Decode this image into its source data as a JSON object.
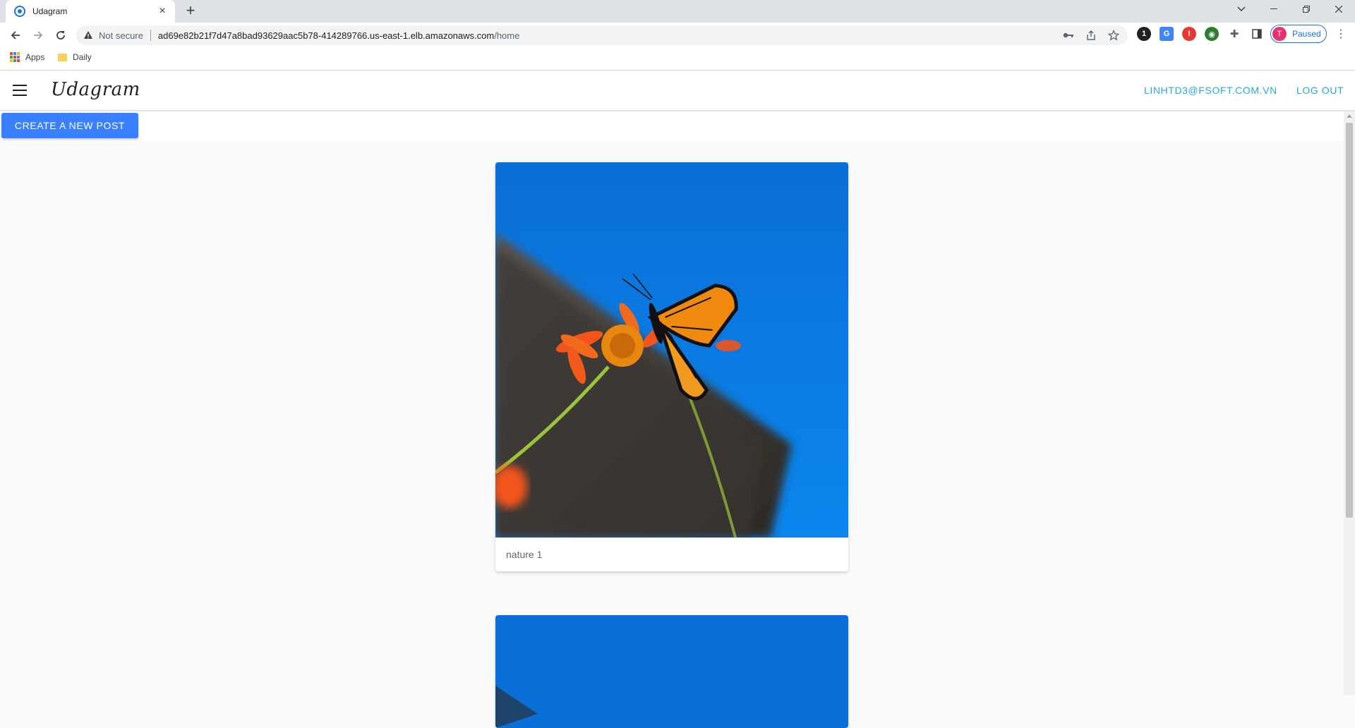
{
  "browser": {
    "tab_title": "Udagram",
    "tab_close": "×",
    "new_tab": "+",
    "not_secure": "Not secure",
    "url_host": "ad69e82b21f7d47a8bad93629aac5b78-414289766.us-east-1.elb.amazonaws.com",
    "url_path": "/home",
    "profile_initial": "T",
    "profile_status": "Paused",
    "bookmarks": [
      "Apps",
      "Daily"
    ],
    "extension_badge": "1"
  },
  "header": {
    "brand": "Udagram",
    "user_email": "LINHTD3@FSOFT.COM.VN",
    "logout": "LOG OUT"
  },
  "main": {
    "create_button": "CREATE A NEW POST",
    "posts": [
      {
        "caption": "nature 1"
      },
      {
        "caption": ""
      }
    ]
  },
  "colors": {
    "accent": "#3880ff",
    "header_link": "#26a9d3",
    "sky": "#0a74d8"
  }
}
